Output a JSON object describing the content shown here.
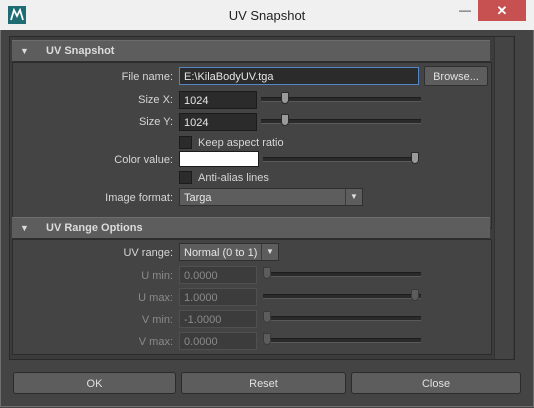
{
  "window": {
    "title": "UV Snapshot",
    "minimize_glyph": "—",
    "close_glyph": "✕"
  },
  "uv_snapshot": {
    "header": "UV Snapshot",
    "file_name_label": "File name:",
    "file_name_value": "E:\\KilaBodyUV.tga",
    "browse_label": "Browse...",
    "size_x_label": "Size X:",
    "size_x_value": "1024",
    "size_y_label": "Size Y:",
    "size_y_value": "1024",
    "keep_aspect_label": "Keep aspect ratio",
    "keep_aspect_checked": false,
    "color_value_label": "Color value:",
    "color_value": "#ffffff",
    "anti_alias_label": "Anti-alias lines",
    "anti_alias_checked": false,
    "image_format_label": "Image format:",
    "image_format_value": "Targa"
  },
  "uv_range": {
    "header": "UV Range Options",
    "range_label": "UV range:",
    "range_value": "Normal (0 to 1)",
    "u_min_label": "U min:",
    "u_min_value": "0.0000",
    "u_max_label": "U max:",
    "u_max_value": "1.0000",
    "v_min_label": "V min:",
    "v_min_value": "-1.0000",
    "v_max_label": "V max:",
    "v_max_value": "0.0000"
  },
  "buttons": {
    "ok": "OK",
    "reset": "Reset",
    "close": "Close"
  },
  "icons": {
    "app": "maya-app-icon",
    "collapse": "collapse-arrow-icon",
    "dropdown": "chevron-down-icon"
  },
  "colors": {
    "panel": "#444444",
    "header": "#5d5d5d",
    "field": "#2b2b2b",
    "focus": "#5286c4",
    "close_button": "#c75050"
  }
}
